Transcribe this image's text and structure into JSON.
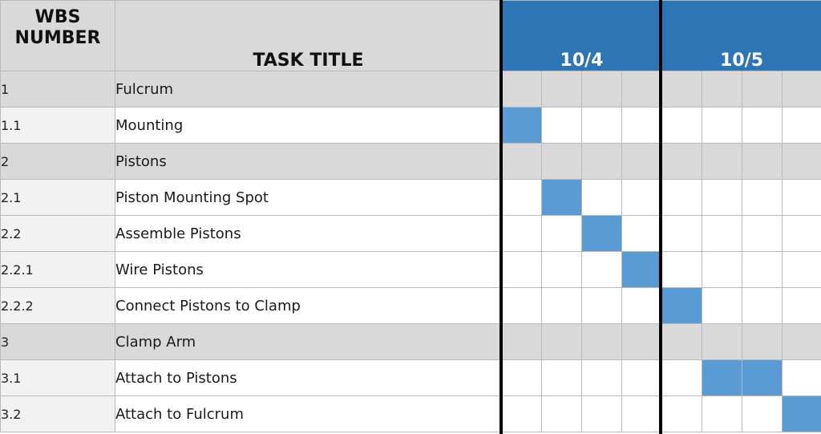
{
  "header": {
    "wbs_line1": "WBS",
    "wbs_line2": "NUMBER",
    "task_title": "TASK TITLE",
    "days": [
      "10/4",
      "10/5"
    ]
  },
  "slots_per_day": 4,
  "colors": {
    "header_gray": "#d9d9d9",
    "day_header_blue": "#2e75b6",
    "task_bar_blue": "#5b9bd5",
    "parent_row_gray": "#d9d9d9",
    "child_wbs_gray": "#f2f2f2"
  },
  "rows": [
    {
      "wbs": "1",
      "title": "Fulcrum",
      "parent": true,
      "filled": []
    },
    {
      "wbs": "1.1",
      "title": "Mounting",
      "parent": false,
      "filled": [
        0
      ]
    },
    {
      "wbs": "2",
      "title": "Pistons",
      "parent": true,
      "filled": []
    },
    {
      "wbs": "2.1",
      "title": "Piston Mounting Spot",
      "parent": false,
      "filled": [
        1
      ]
    },
    {
      "wbs": "2.2",
      "title": "Assemble Pistons",
      "parent": false,
      "filled": [
        2
      ]
    },
    {
      "wbs": "2.2.1",
      "title": "Wire Pistons",
      "parent": false,
      "filled": [
        3
      ]
    },
    {
      "wbs": "2.2.2",
      "title": "Connect Pistons to Clamp",
      "parent": false,
      "filled": [
        4
      ]
    },
    {
      "wbs": "3",
      "title": "Clamp Arm",
      "parent": true,
      "filled": []
    },
    {
      "wbs": "3.1",
      "title": "Attach to Pistons",
      "parent": false,
      "filled": [
        5,
        6
      ]
    },
    {
      "wbs": "3.2",
      "title": "Attach to Fulcrum",
      "parent": false,
      "filled": [
        7
      ]
    }
  ]
}
